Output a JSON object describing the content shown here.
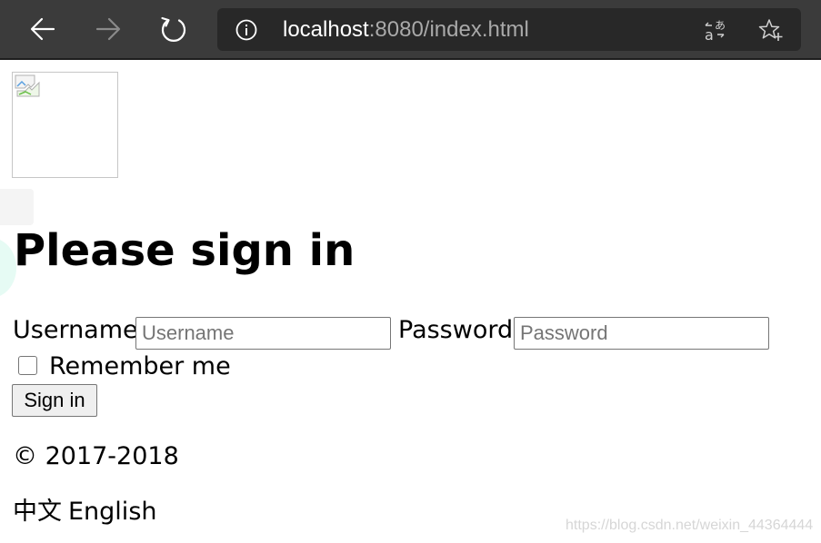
{
  "browser": {
    "url_host": "localhost",
    "url_rest": ":8080/index.html",
    "icons": {
      "back": "arrow-left-icon",
      "forward": "arrow-right-icon",
      "refresh": "refresh-icon",
      "info": "info-icon",
      "translate": "translate-icon",
      "favorite": "star-add-icon"
    },
    "colors": {
      "toolbar": "#3b3b3b",
      "address_bar": "#282828",
      "url_host": "#ffffff",
      "url_rest": "#a9a9a9"
    }
  },
  "page": {
    "logo_icon": "broken-image-icon",
    "heading": "Please sign in",
    "username_label": "Username",
    "username_placeholder": "Username",
    "password_label": "Password",
    "password_placeholder": "Password",
    "remember_label": "Remember me",
    "signin_label": "Sign in",
    "copyright": "© 2017-2018",
    "lang_zh": "中文",
    "lang_en": "English"
  },
  "watermark": "https://blog.csdn.net/weixin_44364444"
}
